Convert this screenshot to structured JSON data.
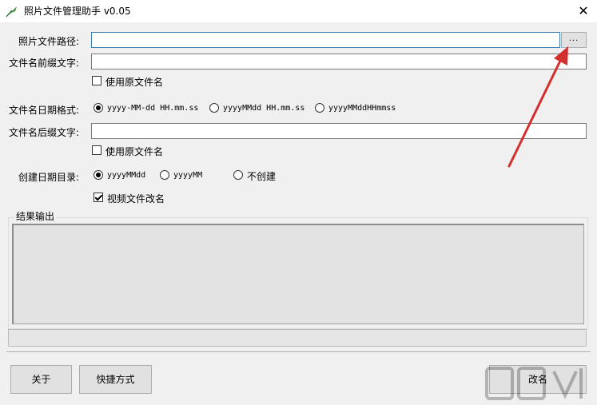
{
  "window": {
    "title": "照片文件管理助手 v0.05",
    "close_symbol": "✕"
  },
  "form": {
    "photo_path": {
      "label": "照片文件路径:",
      "value": "",
      "browse_label": "..."
    },
    "prefix": {
      "label": "文件名前缀文字:",
      "value": ""
    },
    "prefix_use_original": {
      "label": "使用原文件名",
      "checked": false
    },
    "date_format": {
      "label": "文件名日期格式:",
      "options": [
        {
          "label": "yyyy-MM-dd HH.mm.ss",
          "checked": true
        },
        {
          "label": "yyyyMMdd HH.mm.ss",
          "checked": false
        },
        {
          "label": "yyyyMMddHHmmss",
          "checked": false
        }
      ]
    },
    "suffix": {
      "label": "文件名后缀文字:",
      "value": ""
    },
    "suffix_use_original": {
      "label": "使用原文件名",
      "checked": false
    },
    "date_dir": {
      "label": "创建日期目录:",
      "options": [
        {
          "label": "yyyyMMdd",
          "checked": true
        },
        {
          "label": "yyyyMM",
          "checked": false
        },
        {
          "label": "不创建",
          "checked": false
        }
      ]
    },
    "video_rename": {
      "label": "视频文件改名",
      "checked": true
    }
  },
  "output": {
    "group_label": "结果输出",
    "text": ""
  },
  "progress": {
    "value": 0
  },
  "buttons": {
    "about": "关于",
    "shortcut": "快捷方式",
    "rename": "改名"
  },
  "colors": {
    "accent_border": "#3c7fb1",
    "arrow": "#d32f2f"
  }
}
